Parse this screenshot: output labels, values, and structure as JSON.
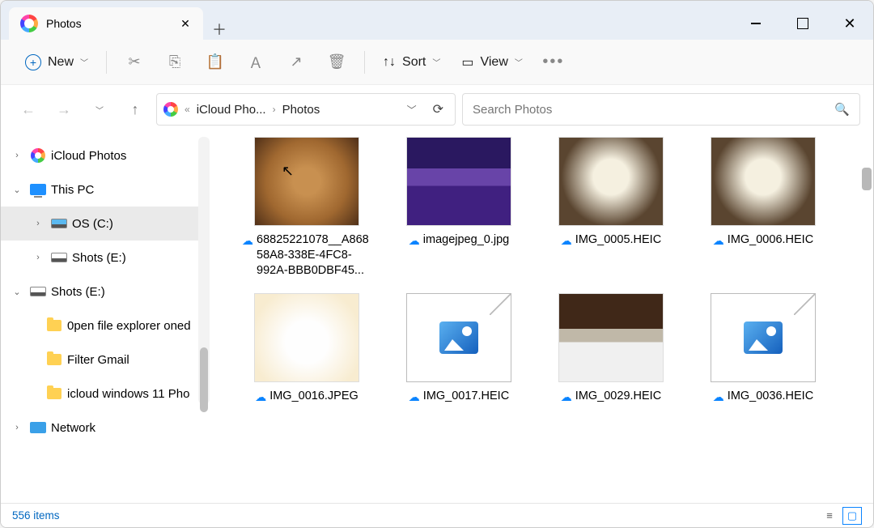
{
  "tab": {
    "title": "Photos"
  },
  "toolbar": {
    "new_label": "New",
    "sort_label": "Sort",
    "view_label": "View"
  },
  "breadcrumb": {
    "seg1": "iCloud Pho...",
    "seg2": "Photos"
  },
  "search": {
    "placeholder": "Search Photos"
  },
  "sidebar": {
    "items": [
      {
        "label": "iCloud Photos"
      },
      {
        "label": "This PC"
      },
      {
        "label": "OS (C:)"
      },
      {
        "label": "Shots (E:)"
      },
      {
        "label": "Shots (E:)"
      },
      {
        "label": "0pen file explorer oned"
      },
      {
        "label": "Filter Gmail"
      },
      {
        "label": "icloud windows 11 Pho"
      },
      {
        "label": "Network"
      }
    ]
  },
  "files": [
    {
      "name": "68825221078__A86858A8-338E-4FC8-992A-BBB0DBF45..."
    },
    {
      "name": "imagejpeg_0.jpg"
    },
    {
      "name": "IMG_0005.HEIC"
    },
    {
      "name": "IMG_0006.HEIC"
    },
    {
      "name": "IMG_0016.JPEG"
    },
    {
      "name": "IMG_0017.HEIC"
    },
    {
      "name": "IMG_0029.HEIC"
    },
    {
      "name": "IMG_0036.HEIC"
    }
  ],
  "status": {
    "text": "556 items"
  }
}
